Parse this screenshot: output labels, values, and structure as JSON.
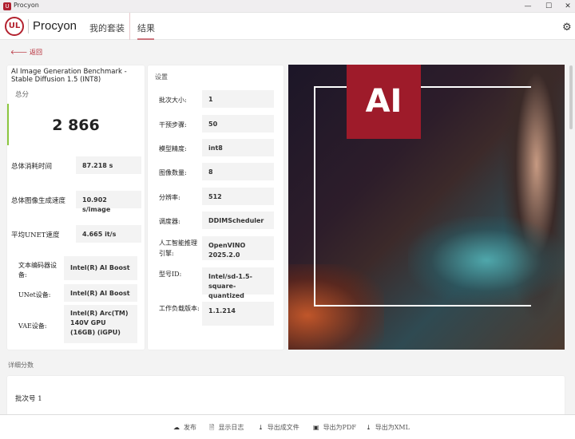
{
  "window": {
    "title": "Procyon",
    "minimize": "—",
    "maximize": "☐",
    "close": "✕"
  },
  "header": {
    "brand": "Procyon",
    "logo": "UL",
    "nav": [
      "我的套装",
      "结果"
    ]
  },
  "back_label": "返回",
  "summary": {
    "title": "AI Image Generation Benchmark - Stable Diffusion 1.5 (INT8)",
    "score_label": "总分",
    "score": "2 866",
    "metrics": [
      {
        "label": "总体消耗时间",
        "value": "87.218 s"
      },
      {
        "label": "总体图像生成速度",
        "value": "10.902 s/image"
      },
      {
        "label": "平均UNET速度",
        "value": "4.665 it/s"
      }
    ],
    "devices": [
      {
        "label": "文本编码器设备:",
        "value": "Intel(R) AI Boost"
      },
      {
        "label": "UNet设备:",
        "value": "Intel(R) AI Boost"
      },
      {
        "label": "VAE设备:",
        "value": "Intel(R) Arc(TM) 140V GPU (16GB) (iGPU)"
      }
    ]
  },
  "settings": {
    "title": "设置",
    "rows": [
      {
        "label": "批次大小:",
        "value": "1"
      },
      {
        "label": "干预步骤:",
        "value": "50"
      },
      {
        "label": "模型精度:",
        "value": "int8"
      },
      {
        "label": "图像数量:",
        "value": "8"
      },
      {
        "label": "分辨率:",
        "value": "512"
      },
      {
        "label": "调度器:",
        "value": "DDIMScheduler"
      },
      {
        "label": "人工智能推理引擎:",
        "value": "OpenVINO 2025.2.0"
      },
      {
        "label": "型号ID:",
        "value": "Intel/sd-1.5-square-quantized"
      },
      {
        "label": "工作负载版本:",
        "value": "1.1.214"
      }
    ]
  },
  "details": {
    "title": "详细分数",
    "batch": "批次号 1"
  },
  "footer": [
    "发布",
    "显示日志",
    "导出成文件",
    "导出为PDF",
    "导出为XML"
  ],
  "colors": {
    "accent": "#b3222f",
    "score_bar": "#8cc63f"
  }
}
